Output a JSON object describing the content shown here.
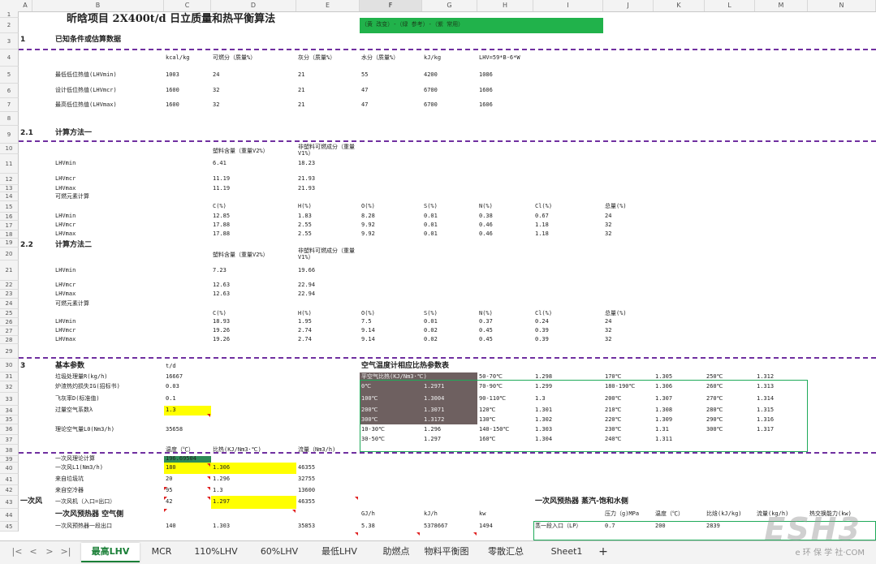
{
  "columns": [
    "A",
    "B",
    "C",
    "D",
    "E",
    "F",
    "G",
    "H",
    "I",
    "J",
    "K",
    "L",
    "M",
    "N"
  ],
  "selected_column": "F",
  "rows": [
    "1",
    "2",
    "3",
    "4",
    "5",
    "6",
    "7",
    "8",
    "9",
    "10",
    "11",
    "12",
    "13",
    "14",
    "15",
    "16",
    "17",
    "18",
    "19",
    "20",
    "21",
    "22",
    "23",
    "24",
    "25",
    "26",
    "27",
    "28",
    "29",
    "30",
    "31",
    "32",
    "33",
    "34",
    "35",
    "36",
    "37",
    "38",
    "39",
    "40",
    "41",
    "42",
    "43",
    "44",
    "45"
  ],
  "colors": {
    "green": "#21b24b",
    "yellow": "#ffff00",
    "dark": "#6e6060",
    "darkgreen": "#2e8b57",
    "purple": "#7030a0",
    "box": "#1faa59",
    "tab_active": "#1a7f37"
  },
  "sheet": {
    "title": "昕晗项目 2X400t/d 日立质量和热平衡算法",
    "legend_bar": "（黄 改变）-（绿 参考）-（紫 常用）",
    "s1_num": "1",
    "s1_title": "已知条件或估算数据",
    "h4": [
      "kcal/kg",
      "可燃分（质量%）",
      "灰分（质量%）",
      "水分（质量%）",
      "kJ/kg",
      "LHV=59*B-6*W"
    ],
    "r5": [
      "最低低位热值(LHVmin)",
      "1003",
      "24",
      "21",
      "55",
      "4200",
      "1086"
    ],
    "r6": [
      "设计低位热值(LHVmcr)",
      "1600",
      "32",
      "21",
      "47",
      "6700",
      "1606"
    ],
    "r7": [
      "最高低位热值(LHVmax)",
      "1600",
      "32",
      "21",
      "47",
      "6700",
      "1606"
    ],
    "s21_num": "2.1",
    "s21_title": "计算方法一",
    "r10": [
      "塑料含量（重量V2%）",
      "非塑料可燃成分（重量V1%）"
    ],
    "r11": [
      "LHVmin",
      "6.41",
      "18.23"
    ],
    "r12": [
      "LHVmcr",
      "11.19",
      "21.93"
    ],
    "r13": [
      "LHVmax",
      "11.19",
      "21.93"
    ],
    "r14": "可燃元素计算",
    "r15": [
      "C(%)",
      "H(%)",
      "O(%)",
      "S(%)",
      "N(%)",
      "Cl(%)",
      "总量(%)"
    ],
    "r16": [
      "LHVmin",
      "12.85",
      "1.83",
      "8.28",
      "0.01",
      "0.38",
      "0.67",
      "24"
    ],
    "r17": [
      "LHVmcr",
      "17.88",
      "2.55",
      "9.92",
      "0.01",
      "0.46",
      "1.18",
      "32"
    ],
    "r18": [
      "LHVmax",
      "17.88",
      "2.55",
      "9.92",
      "0.01",
      "0.46",
      "1.18",
      "32"
    ],
    "s22_num": "2.2",
    "s22_title": "计算方法二",
    "r20": [
      "塑料含量（重量V2%）",
      "非塑料可燃成分（重量V1%）"
    ],
    "r21": [
      "LHVmin",
      "7.23",
      "19.66"
    ],
    "r22": [
      "LHVmcr",
      "12.63",
      "22.94"
    ],
    "r23": [
      "LHVmax",
      "12.63",
      "22.94"
    ],
    "r24": "可燃元素计算",
    "r25": [
      "C(%)",
      "H(%)",
      "O(%)",
      "S(%)",
      "N(%)",
      "Cl(%)",
      "总量(%)"
    ],
    "r26": [
      "LHVmin",
      "18.93",
      "1.95",
      "7.5",
      "0.01",
      "0.37",
      "0.24",
      "24"
    ],
    "r27": [
      "LHVmcr",
      "19.26",
      "2.74",
      "9.14",
      "0.02",
      "0.45",
      "0.39",
      "32"
    ],
    "r28": [
      "LHVmax",
      "19.26",
      "2.74",
      "9.14",
      "0.02",
      "0.45",
      "0.39",
      "32"
    ],
    "s3_num": "3",
    "s3_title": "基本参数",
    "s3_unit": "t/d",
    "air_title": "空气温度计相应比热参数表",
    "params": [
      [
        "垃圾处理量R(kg/h)",
        "16667"
      ],
      [
        "炉渣热灼损失IG(招标书)",
        "0.03"
      ],
      [
        "飞灰率D(标准值)",
        "0.1"
      ],
      [
        "过量空气系数λ",
        "1.3"
      ],
      [
        "",
        ""
      ],
      [
        "理论空气量L0(Nm3/h)",
        "35658"
      ]
    ],
    "air_table": [
      [
        "平空气比热(KJ/Nm3·℃)",
        "",
        "50-70℃",
        "1.298",
        "170℃",
        "1.305",
        "250℃",
        "1.312"
      ],
      [
        "0℃",
        "1.2971",
        "70-90℃",
        "1.299",
        "180-190℃",
        "1.306",
        "260℃",
        "1.313"
      ],
      [
        "100℃",
        "1.3004",
        "90-110℃",
        "1.3",
        "200℃",
        "1.307",
        "270℃",
        "1.314"
      ],
      [
        "200℃",
        "1.3071",
        "120℃",
        "1.301",
        "210℃",
        "1.308",
        "280℃",
        "1.315"
      ],
      [
        "300℃",
        "1.3172",
        "130℃",
        "1.302",
        "220℃",
        "1.309",
        "290℃",
        "1.316"
      ],
      [
        "10-30℃",
        "1.296",
        "140-150℃",
        "1.303",
        "230℃",
        "1.31",
        "300℃",
        "1.317"
      ],
      [
        "30-50℃",
        "1.297",
        "160℃",
        "1.304",
        "240℃",
        "1.311",
        "",
        ""
      ]
    ],
    "r38": [
      "温度（℃）",
      "比热(KJ/Nm3·℃)",
      "流量（Nm3/h)"
    ],
    "primary_rows": [
      [
        "一次风理论计算",
        "196.69504",
        "",
        ""
      ],
      [
        "一次风L1(Nm3/h)",
        "180",
        "1.306",
        "46355"
      ],
      [
        "来自垃圾坑",
        "20",
        "1.296",
        "32755"
      ],
      [
        "来自空冷器",
        "95",
        "1.3",
        "13600"
      ],
      [
        "一次风机（入口=出口）",
        "42",
        "1.297",
        "46355"
      ]
    ],
    "a43": "一次风",
    "r44": [
      "一次风预热器 空气侧",
      "GJ/h",
      "kJ/h",
      "kw"
    ],
    "r45": [
      "一次风预热器一段出口",
      "140",
      "1.303",
      "35853",
      "5.38",
      "5378667",
      "1494"
    ],
    "steam_title": "一次风预热器 蒸汽-饱和水侧",
    "r44r": [
      "压力（g)MPa",
      "温度（℃）",
      "比焓(kJ/kg)",
      "流量(kg/h)",
      "热交换能力(kw)"
    ],
    "r45r": [
      "蒸一段入口（LP）",
      "0.7",
      "200",
      "2839"
    ]
  },
  "tabs": [
    "最高LHV",
    "MCR",
    "110%LHV",
    "60%LHV",
    "最低LHV",
    "助燃点",
    "物料平衡图",
    "零散汇总",
    "Sheet1"
  ],
  "active_tab": "最高LHV",
  "watermark": {
    "big": "ESH3",
    "small": "e 环 保 学 社·COM"
  }
}
